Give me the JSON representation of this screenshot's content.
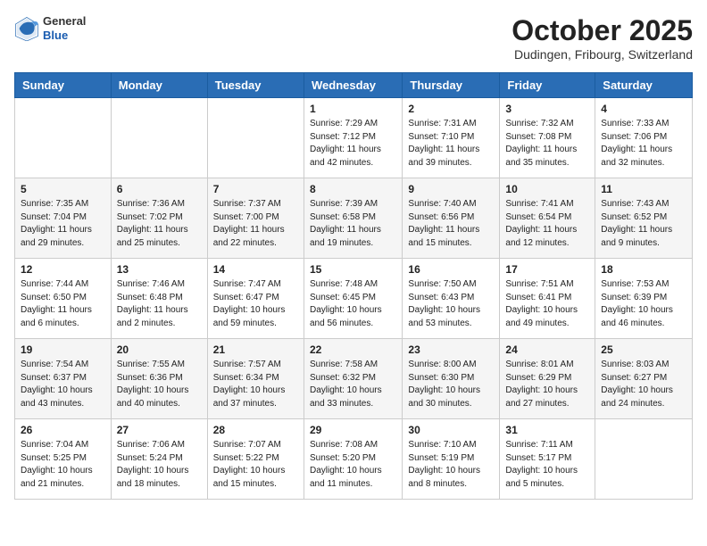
{
  "header": {
    "logo_general": "General",
    "logo_blue": "Blue",
    "month": "October 2025",
    "location": "Dudingen, Fribourg, Switzerland"
  },
  "weekdays": [
    "Sunday",
    "Monday",
    "Tuesday",
    "Wednesday",
    "Thursday",
    "Friday",
    "Saturday"
  ],
  "weeks": [
    [
      {
        "day": "",
        "info": ""
      },
      {
        "day": "",
        "info": ""
      },
      {
        "day": "",
        "info": ""
      },
      {
        "day": "1",
        "info": "Sunrise: 7:29 AM\nSunset: 7:12 PM\nDaylight: 11 hours\nand 42 minutes."
      },
      {
        "day": "2",
        "info": "Sunrise: 7:31 AM\nSunset: 7:10 PM\nDaylight: 11 hours\nand 39 minutes."
      },
      {
        "day": "3",
        "info": "Sunrise: 7:32 AM\nSunset: 7:08 PM\nDaylight: 11 hours\nand 35 minutes."
      },
      {
        "day": "4",
        "info": "Sunrise: 7:33 AM\nSunset: 7:06 PM\nDaylight: 11 hours\nand 32 minutes."
      }
    ],
    [
      {
        "day": "5",
        "info": "Sunrise: 7:35 AM\nSunset: 7:04 PM\nDaylight: 11 hours\nand 29 minutes."
      },
      {
        "day": "6",
        "info": "Sunrise: 7:36 AM\nSunset: 7:02 PM\nDaylight: 11 hours\nand 25 minutes."
      },
      {
        "day": "7",
        "info": "Sunrise: 7:37 AM\nSunset: 7:00 PM\nDaylight: 11 hours\nand 22 minutes."
      },
      {
        "day": "8",
        "info": "Sunrise: 7:39 AM\nSunset: 6:58 PM\nDaylight: 11 hours\nand 19 minutes."
      },
      {
        "day": "9",
        "info": "Sunrise: 7:40 AM\nSunset: 6:56 PM\nDaylight: 11 hours\nand 15 minutes."
      },
      {
        "day": "10",
        "info": "Sunrise: 7:41 AM\nSunset: 6:54 PM\nDaylight: 11 hours\nand 12 minutes."
      },
      {
        "day": "11",
        "info": "Sunrise: 7:43 AM\nSunset: 6:52 PM\nDaylight: 11 hours\nand 9 minutes."
      }
    ],
    [
      {
        "day": "12",
        "info": "Sunrise: 7:44 AM\nSunset: 6:50 PM\nDaylight: 11 hours\nand 6 minutes."
      },
      {
        "day": "13",
        "info": "Sunrise: 7:46 AM\nSunset: 6:48 PM\nDaylight: 11 hours\nand 2 minutes."
      },
      {
        "day": "14",
        "info": "Sunrise: 7:47 AM\nSunset: 6:47 PM\nDaylight: 10 hours\nand 59 minutes."
      },
      {
        "day": "15",
        "info": "Sunrise: 7:48 AM\nSunset: 6:45 PM\nDaylight: 10 hours\nand 56 minutes."
      },
      {
        "day": "16",
        "info": "Sunrise: 7:50 AM\nSunset: 6:43 PM\nDaylight: 10 hours\nand 53 minutes."
      },
      {
        "day": "17",
        "info": "Sunrise: 7:51 AM\nSunset: 6:41 PM\nDaylight: 10 hours\nand 49 minutes."
      },
      {
        "day": "18",
        "info": "Sunrise: 7:53 AM\nSunset: 6:39 PM\nDaylight: 10 hours\nand 46 minutes."
      }
    ],
    [
      {
        "day": "19",
        "info": "Sunrise: 7:54 AM\nSunset: 6:37 PM\nDaylight: 10 hours\nand 43 minutes."
      },
      {
        "day": "20",
        "info": "Sunrise: 7:55 AM\nSunset: 6:36 PM\nDaylight: 10 hours\nand 40 minutes."
      },
      {
        "day": "21",
        "info": "Sunrise: 7:57 AM\nSunset: 6:34 PM\nDaylight: 10 hours\nand 37 minutes."
      },
      {
        "day": "22",
        "info": "Sunrise: 7:58 AM\nSunset: 6:32 PM\nDaylight: 10 hours\nand 33 minutes."
      },
      {
        "day": "23",
        "info": "Sunrise: 8:00 AM\nSunset: 6:30 PM\nDaylight: 10 hours\nand 30 minutes."
      },
      {
        "day": "24",
        "info": "Sunrise: 8:01 AM\nSunset: 6:29 PM\nDaylight: 10 hours\nand 27 minutes."
      },
      {
        "day": "25",
        "info": "Sunrise: 8:03 AM\nSunset: 6:27 PM\nDaylight: 10 hours\nand 24 minutes."
      }
    ],
    [
      {
        "day": "26",
        "info": "Sunrise: 7:04 AM\nSunset: 5:25 PM\nDaylight: 10 hours\nand 21 minutes."
      },
      {
        "day": "27",
        "info": "Sunrise: 7:06 AM\nSunset: 5:24 PM\nDaylight: 10 hours\nand 18 minutes."
      },
      {
        "day": "28",
        "info": "Sunrise: 7:07 AM\nSunset: 5:22 PM\nDaylight: 10 hours\nand 15 minutes."
      },
      {
        "day": "29",
        "info": "Sunrise: 7:08 AM\nSunset: 5:20 PM\nDaylight: 10 hours\nand 11 minutes."
      },
      {
        "day": "30",
        "info": "Sunrise: 7:10 AM\nSunset: 5:19 PM\nDaylight: 10 hours\nand 8 minutes."
      },
      {
        "day": "31",
        "info": "Sunrise: 7:11 AM\nSunset: 5:17 PM\nDaylight: 10 hours\nand 5 minutes."
      },
      {
        "day": "",
        "info": ""
      }
    ]
  ]
}
